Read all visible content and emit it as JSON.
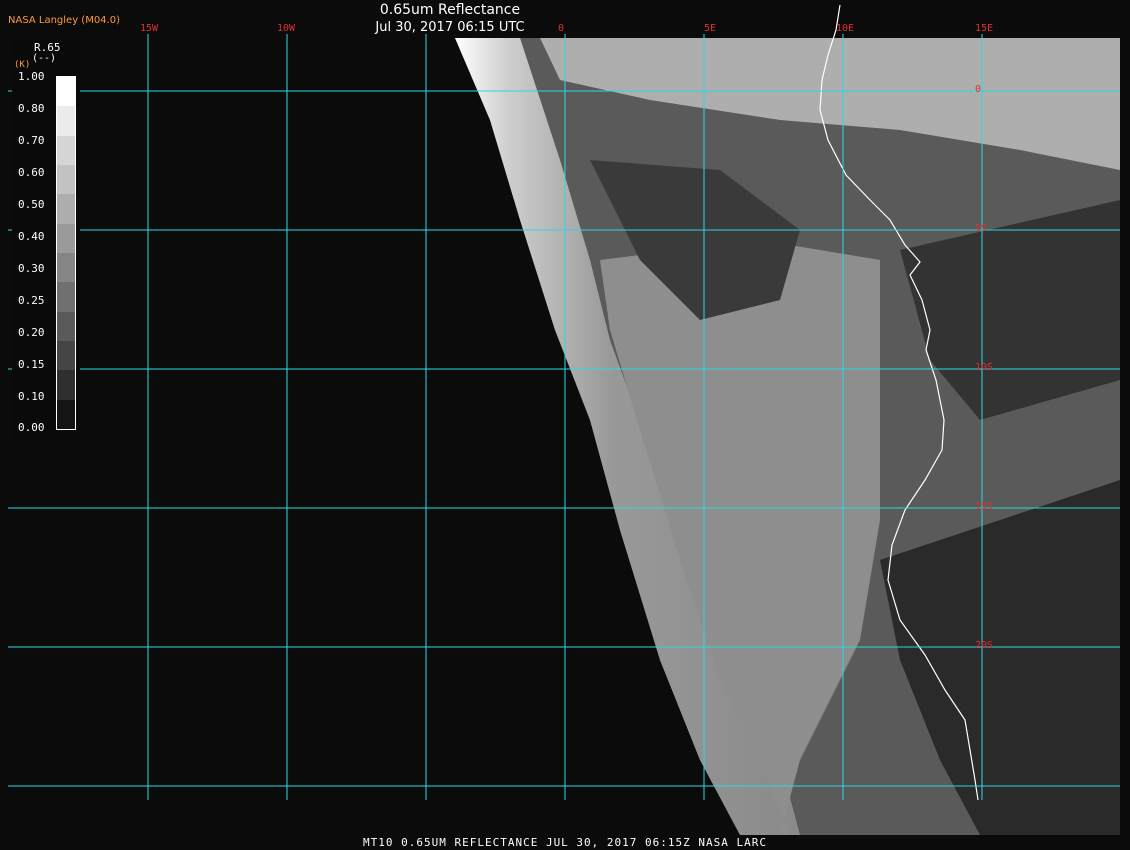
{
  "header": {
    "credit": "NASA Langley (M04.0)",
    "title": "0.65um Reflectance",
    "subtitle": "Jul 30, 2017 06:15 UTC"
  },
  "footer": {
    "caption": "MT10  0.65UM REFLECTANCE   JUL 30, 2017 06:15Z   NASA LARC"
  },
  "legend": {
    "title": "R.65",
    "unit": "(--)",
    "unit_small": "(K)",
    "ticks": [
      "1.00",
      "0.80",
      "0.70",
      "0.60",
      "0.50",
      "0.40",
      "0.30",
      "0.25",
      "0.20",
      "0.15",
      "0.10",
      "0.00"
    ],
    "colors": [
      "#ffffff",
      "#ececec",
      "#d6d6d6",
      "#c2c2c2",
      "#aeaeae",
      "#9a9a9a",
      "#858585",
      "#707070",
      "#5a5a5a",
      "#454545",
      "#2f2f2f",
      "#141414"
    ]
  },
  "grid": {
    "longitude_labels": [
      "15W",
      "10W",
      "0",
      "5E",
      "10E",
      "15E"
    ],
    "latitude_labels": [
      "0",
      "5S",
      "10S",
      "15S",
      "20S"
    ],
    "line_color": "#2fd8e0",
    "label_color": "#e03030"
  },
  "colors": {
    "ocean_clear": "#0b0b0b",
    "coastline": "#ffffff"
  }
}
